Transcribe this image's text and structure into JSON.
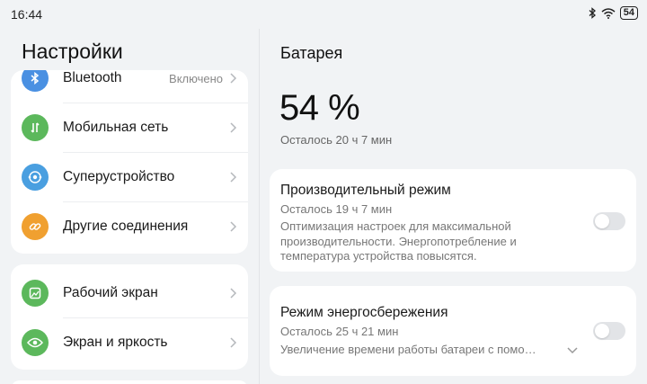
{
  "status_bar": {
    "time": "16:44",
    "battery_level": "54",
    "icons": [
      "bluetooth-icon",
      "wifi-icon",
      "battery-icon"
    ]
  },
  "left": {
    "title": "Настройки",
    "group1": [
      {
        "label": "Bluetooth",
        "value": "Включено",
        "icon": "bluetooth-icon",
        "color": "#4a90e2"
      },
      {
        "label": "Мобильная сеть",
        "icon": "mobile-network-icon",
        "color": "#5cb85c"
      },
      {
        "label": "Суперустройство",
        "icon": "super-device-icon",
        "color": "#4a9fe0"
      },
      {
        "label": "Другие соединения",
        "icon": "link-icon",
        "color": "#f0a030"
      }
    ],
    "group2": [
      {
        "label": "Рабочий экран",
        "icon": "home-screen-icon",
        "color": "#5cb85c"
      },
      {
        "label": "Экран и яркость",
        "icon": "eye-icon",
        "color": "#5cb85c"
      }
    ]
  },
  "right": {
    "title": "Батарея",
    "percent": "54 %",
    "remaining": "Осталось 20 ч 7 мин",
    "modes": [
      {
        "title": "Производительный режим",
        "subtitle": "Осталось 19 ч 7 мин",
        "description": "Оптимизация настроек для максимальной производительности. Энергопотребление и температура устройства повысятся.",
        "enabled": false
      },
      {
        "title": "Режим энергосбережения",
        "subtitle": "Осталось 25 ч 21 мин",
        "description": "Увеличение времени работы батареи с помо…",
        "enabled": false
      }
    ]
  }
}
